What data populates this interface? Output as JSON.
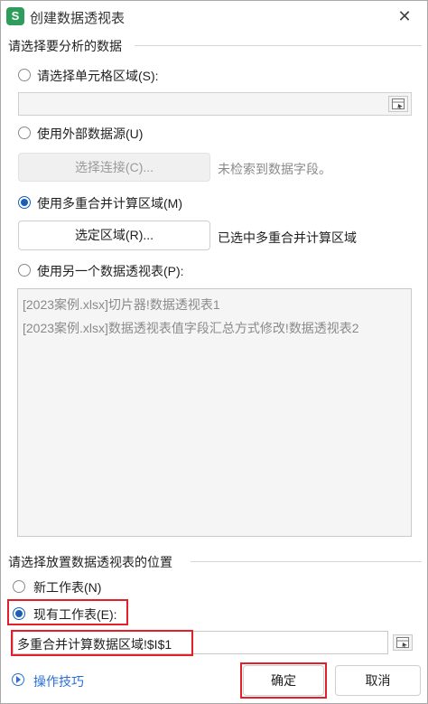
{
  "window": {
    "app_icon": "S",
    "title": "创建数据透视表",
    "close": "✕"
  },
  "source_section": {
    "title": "请选择要分析的数据",
    "opt_cells": {
      "label": "请选择单元格区域(S):",
      "checked": false,
      "value": ""
    },
    "opt_external": {
      "label": "使用外部数据源(U)",
      "checked": false
    },
    "connect_button": "选择连接(C)...",
    "connect_hint": "未检索到数据字段。",
    "opt_multi": {
      "label": "使用多重合并计算区域(M)",
      "checked": true
    },
    "select_area_button": "选定区域(R)...",
    "select_area_hint": "已选中多重合并计算区域",
    "opt_other_pivot": {
      "label": "使用另一个数据透视表(P):",
      "checked": false
    },
    "pivot_list": [
      "[2023案例.xlsx]切片器!数据透视表1",
      "[2023案例.xlsx]数据透视表值字段汇总方式修改!数据透视表2"
    ]
  },
  "dest_section": {
    "title": "请选择放置数据透视表的位置",
    "opt_new": {
      "label": "新工作表(N)",
      "checked": false
    },
    "opt_existing": {
      "label": "现有工作表(E):",
      "checked": true
    },
    "location_value": "多重合并计算数据区域!$I$1"
  },
  "footer": {
    "tips": "操作技巧",
    "ok": "确定",
    "cancel": "取消"
  },
  "colors": {
    "accent": "#1a5fb4",
    "highlight": "#e0202a",
    "link": "#2a6fd6",
    "app_green": "#2e9d5b"
  },
  "icons": [
    "spreadsheet-app-icon",
    "close-icon",
    "range-picker-icon",
    "play-tips-icon"
  ]
}
